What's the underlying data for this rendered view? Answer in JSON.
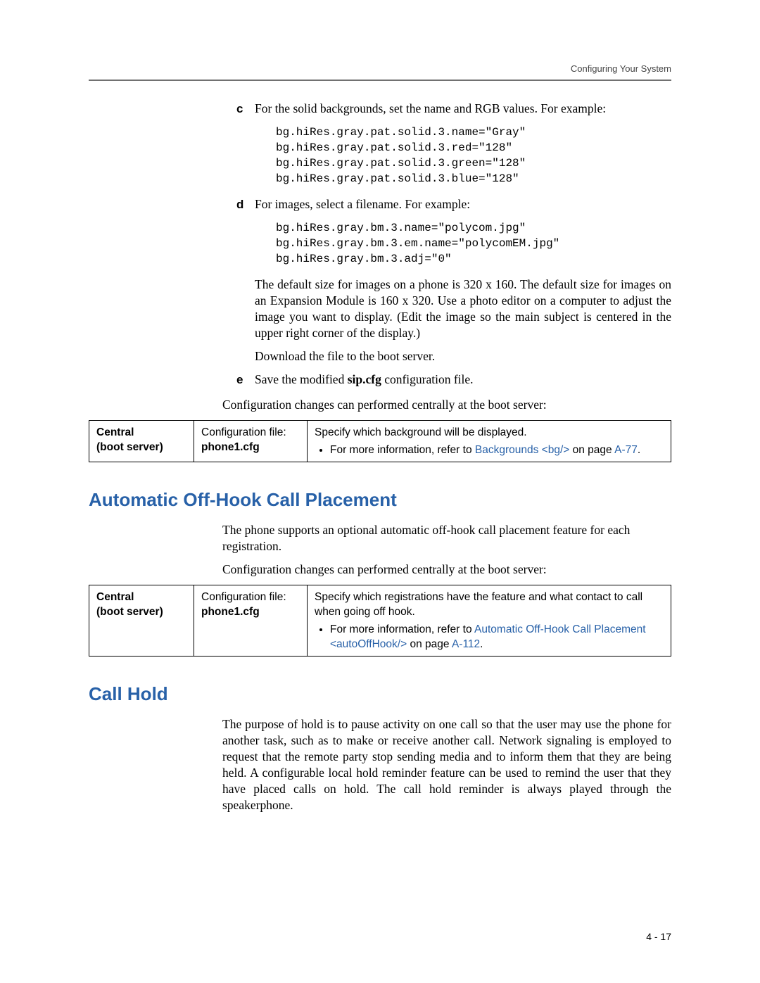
{
  "header": {
    "running": "Configuring Your System"
  },
  "steps": {
    "c": {
      "letter": "c",
      "text": "For the solid backgrounds, set the name and RGB values. For example:"
    },
    "c_code": "bg.hiRes.gray.pat.solid.3.name=\"Gray\"\nbg.hiRes.gray.pat.solid.3.red=\"128\"\nbg.hiRes.gray.pat.solid.3.green=\"128\"\nbg.hiRes.gray.pat.solid.3.blue=\"128\"",
    "d": {
      "letter": "d",
      "text": "For images, select a filename. For example:"
    },
    "d_code": "bg.hiRes.gray.bm.3.name=\"polycom.jpg\"\nbg.hiRes.gray.bm.3.em.name=\"polycomEM.jpg\"\nbg.hiRes.gray.bm.3.adj=\"0\"",
    "d_para1": "The default size for images on a phone is 320 x 160. The default size for images on an Expansion Module is 160 x 320. Use a photo editor on a computer to adjust the image you want to display. (Edit the image so the main subject is centered in the upper right corner of the display.)",
    "d_para2": "Download the file to the boot server.",
    "e": {
      "letter": "e",
      "text_pre": "Save the modified ",
      "text_bold": "sip.cfg",
      "text_post": " configuration file."
    }
  },
  "config_line": "Configuration changes can performed centrally at the boot server:",
  "table1": {
    "col1_l1": "Central",
    "col1_l2": "(boot server)",
    "col2_l1": "Configuration file:",
    "col2_l2": "phone1.cfg",
    "col3_l1": "Specify which background will be displayed.",
    "bullet_pre": "For more information, refer to ",
    "bullet_link": "Backgrounds <bg/>",
    "bullet_mid": " on page ",
    "bullet_page": "A-77",
    "bullet_end": "."
  },
  "section_auto": {
    "title": "Automatic Off-Hook Call Placement",
    "para1": "The phone supports an optional automatic off-hook call placement feature for each registration.",
    "para2": "Configuration changes can performed centrally at the boot server:"
  },
  "table2": {
    "col1_l1": "Central",
    "col1_l2": "(boot server)",
    "col2_l1": "Configuration file:",
    "col2_l2": "phone1.cfg",
    "col3_l1": "Specify which registrations have the feature and what contact to call when going off hook.",
    "bullet_pre": "For more information, refer to ",
    "bullet_link1": "Automatic Off-Hook Call Placement <autoOffHook/>",
    "bullet_mid": " on page ",
    "bullet_page": "A-112",
    "bullet_end": "."
  },
  "section_hold": {
    "title": "Call Hold",
    "para": "The purpose of hold is to pause activity on one call so that the user may use the phone for another task, such as to make or receive another call. Network signaling is employed to request that the remote party stop sending media and to inform them that they are being held. A configurable local hold reminder feature can be used to remind the user that they have placed calls on hold. The call hold reminder is always played through the speakerphone."
  },
  "footer": {
    "page": "4 - 17"
  }
}
